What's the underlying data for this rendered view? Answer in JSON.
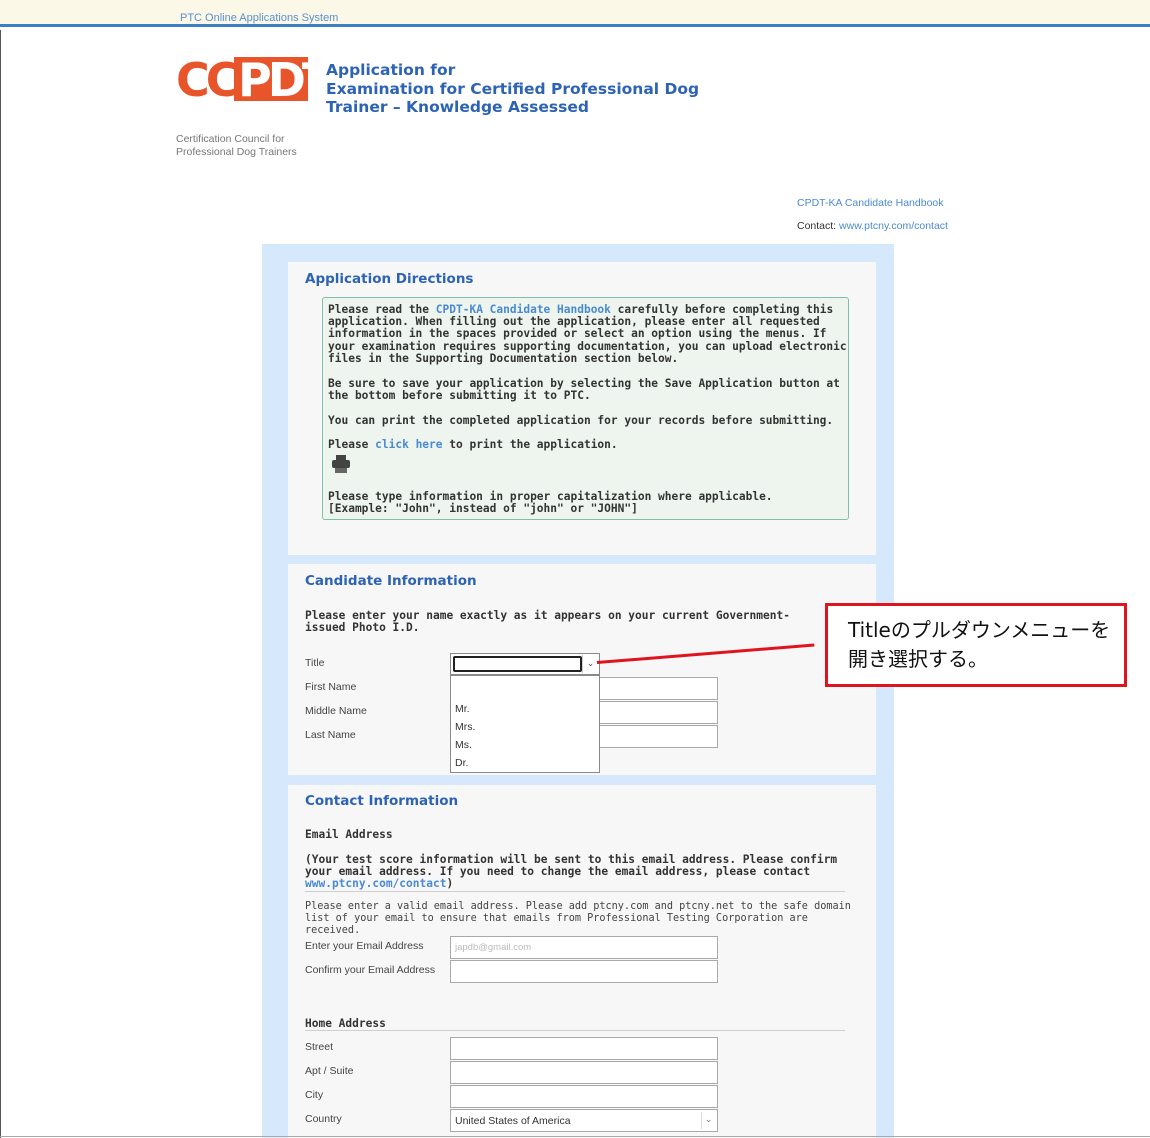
{
  "topbar": {
    "title": "PTC Online Applications System"
  },
  "logo": {
    "mark_left": "CC",
    "mark_right": "PDT",
    "subtitle_line1": "Certification Council for",
    "subtitle_line2": "Professional Dog Trainers"
  },
  "header": {
    "title_line1": "Application for",
    "title_line2": "Examination for Certified Professional Dog",
    "title_line3": "Trainer – Knowledge Assessed"
  },
  "links": {
    "handbook": "CPDT-KA Candidate Handbook",
    "contact_label": "Contact:",
    "contact_url": "www.ptcny.com/contact"
  },
  "directions": {
    "title": "Application Directions",
    "p1_pre": "Please read the ",
    "p1_link": "CPDT-KA Candidate Handbook",
    "p1_post": " carefully before completing this application. When filling out the application, please enter all requested information in the spaces provided or select an option using the menus. If your examination requires supporting documentation, you can upload electronic files in the Supporting Documentation section below.",
    "p2": "Be sure to save your application by selecting the Save Application button at the bottom before submitting it to PTC.",
    "p3": "You can print the completed application for your records before submitting.",
    "p4_pre": "Please ",
    "p4_link": "click here",
    "p4_post": " to print the application.",
    "p5": "Please type information in proper capitalization where applicable.",
    "p6": "[Example: \"John\", instead of \"john\" or \"JOHN\"]",
    "print_icon": "printer-icon"
  },
  "candidate": {
    "title": "Candidate Information",
    "intro": "Please enter your name exactly as it appears on your current Government-issued Photo I.D.",
    "labels": {
      "title": "Title",
      "first": "First Name",
      "middle": "Middle Name",
      "last": "Last Name"
    },
    "title_options": [
      "Mr.",
      "Mrs.",
      "Ms.",
      "Dr."
    ]
  },
  "callout": {
    "text": "Titleのプルダウンメニューを開き選択する。",
    "color": "#e0141e"
  },
  "contact": {
    "title": "Contact Information",
    "email_heading": "Email Address",
    "email_note_pre": "(Your test score information will be sent to this email address. Please confirm your email address. If you need to change the email address, please contact ",
    "email_note_link": "www.ptcny.com/contact",
    "email_note_post": ")",
    "email_help": "Please enter a valid email address. Please add ptcny.com and ptcny.net to the safe domain list of your email to ensure that emails from Professional Testing Corporation are received.",
    "email_label": "Enter your Email Address",
    "email_value": "japdb@gmail.com",
    "confirm_label": "Confirm your Email Address",
    "home_heading": "Home Address",
    "street_label": "Street",
    "apt_label": "Apt / Suite",
    "city_label": "City",
    "country_label": "Country",
    "country_value": "United States of America"
  },
  "colors": {
    "accent": "#2d63b4",
    "link": "#4a8ad4",
    "brand": "#e8552a",
    "panel_bg": "#d6e8fb"
  }
}
